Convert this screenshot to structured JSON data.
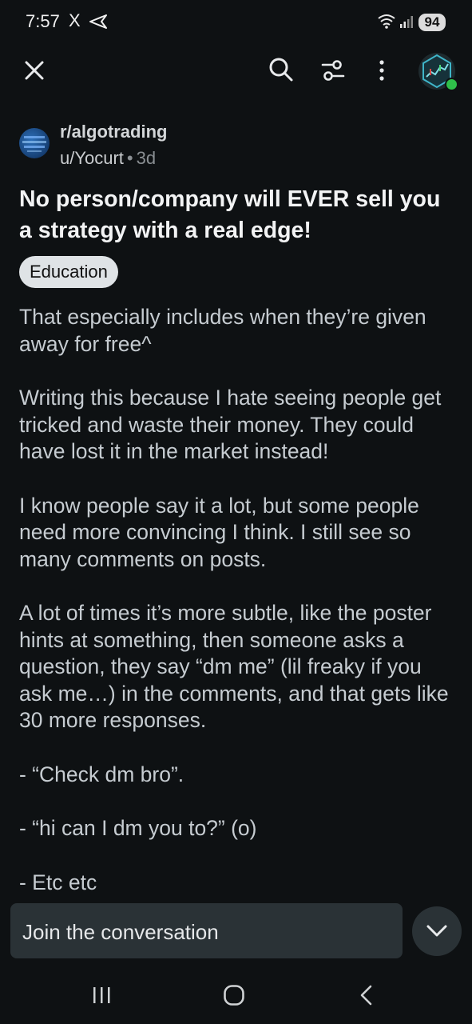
{
  "status_bar": {
    "time": "7:57",
    "x_glyph": "X",
    "battery": "94",
    "icons": [
      "twitter-x-icon",
      "send-icon",
      "wifi-icon",
      "signal-icon",
      "battery-icon"
    ]
  },
  "app_bar": {
    "icons": [
      "close-icon",
      "search-icon",
      "sort-options-icon",
      "more-vert-icon",
      "avatar"
    ],
    "online_color": "#2fbf4a"
  },
  "post": {
    "subreddit": "r/algotrading",
    "author": "u/Yocurt",
    "separator": "•",
    "age": "3d",
    "title": "No person/company will EVER sell you a strategy with a real edge!",
    "flair": "Education",
    "body": [
      "That especially includes when they’re given away for free^",
      "Writing this because I hate seeing people get tricked and waste their money. They could have lost it in the market instead!",
      "I know people say it a lot, but some people need more convincing I think. I still see so many comments on posts.",
      "A lot of times it’s more subtle, like the poster hints at something, then someone asks a question, they say “dm me” (lil freaky if you ask me…) in the comments, and that gets like 30 more responses.",
      "- “Check dm bro”.",
      "- “hi can I dm you to?” (o)",
      "- Etc etc"
    ]
  },
  "composer": {
    "placeholder": "Join the conversation",
    "collapse_icon": "chevron-down-icon"
  },
  "nav_bar": {
    "icons": [
      "recents-icon",
      "home-icon",
      "back-icon"
    ]
  },
  "colors": {
    "background": "#0e1113",
    "surface": "#2a3236",
    "text": "#c6ccd1",
    "flair_bg": "#dfe3e6"
  }
}
